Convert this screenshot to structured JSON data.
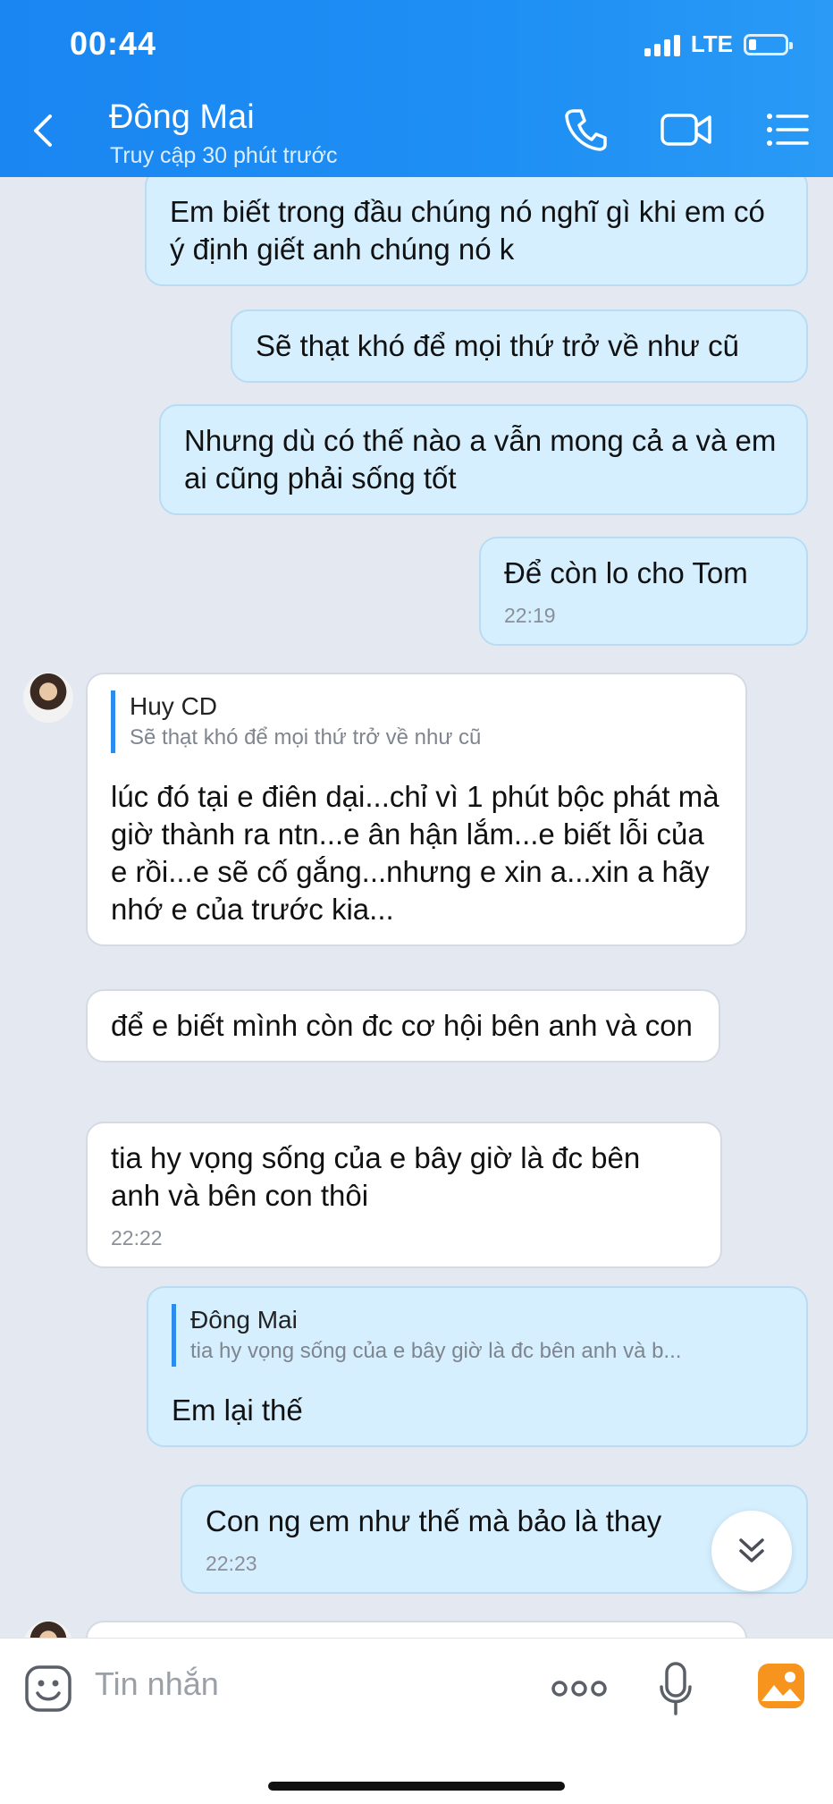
{
  "status_bar": {
    "time": "00:44",
    "network": "LTE"
  },
  "header": {
    "contact_name": "Đông Mai",
    "subtitle": "Truy cập 30 phút trước"
  },
  "messages": [
    {
      "side": "me",
      "text": "Em biết trong đầu chúng nó nghĩ gì khi em có ý định giết anh chúng nó k"
    },
    {
      "side": "me",
      "text": "Sẽ thạt khó để mọi thứ trở về như cũ"
    },
    {
      "side": "me",
      "text": "Nhưng dù có thế nào a vẫn mong cả a và em ai cũng phải sống tốt"
    },
    {
      "side": "me",
      "text": "Để còn lo cho Tom",
      "time": "22:19"
    },
    {
      "side": "them",
      "quote_name": "Huy CD",
      "quote_text": "Sẽ thạt khó để mọi thứ trở về như cũ",
      "text": "lúc đó tại e điên dại...chỉ vì 1 phút bộc phát mà giờ thành ra ntn...e ân hận lắm...e biết lỗi của e rồi...e sẽ cố gắng...nhưng e xin a...xin a hãy nhớ e của trước kia..."
    },
    {
      "side": "them",
      "text": "để e biết mình còn đc cơ hội bên anh và con"
    },
    {
      "side": "them",
      "text": "tia hy vọng sống của e bây giờ là đc bên anh và bên con thôi",
      "time": "22:22"
    },
    {
      "side": "me",
      "quote_name": "Đông Mai",
      "quote_text": "tia hy vọng sống của e bây giờ là đc bên anh và b...",
      "text": "Em lại thế"
    },
    {
      "side": "me",
      "text": "Con ng em như thế mà bảo là thay",
      "time": "22:23"
    }
  ],
  "composer": {
    "placeholder": "Tin nhắn"
  },
  "colors": {
    "header": "#1e8ff4",
    "my_bubble": "#d5efff",
    "their_bubble": "#ffffff",
    "background": "#e3e8f1"
  },
  "icons": [
    "back-icon",
    "phone-icon",
    "video-icon",
    "menu-icon",
    "sticker-icon",
    "more-icon",
    "mic-icon",
    "image-icon",
    "scroll-down-icon"
  ]
}
